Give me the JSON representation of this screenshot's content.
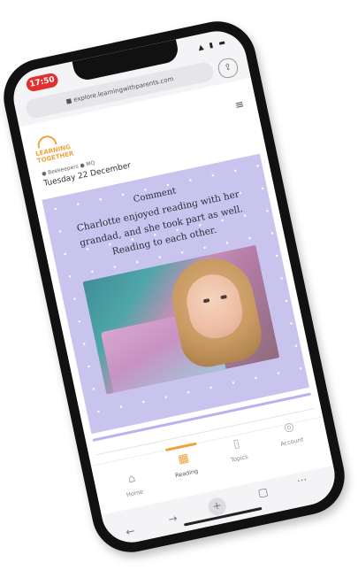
{
  "status_bar": {
    "time": "17:50",
    "icons": "▲ ▮ ▬"
  },
  "browser": {
    "url": "■ explore.learningwithparents.com",
    "share_icon": "share-icon"
  },
  "site": {
    "logo_text": "LEARNING\nTOGETHER",
    "menu_icon": "≡",
    "meta": "● Beekeepers ● MQ",
    "date": "Tuesday 22 December"
  },
  "comment": {
    "title": "Comment",
    "text": "Charlotte enjoyed reading with her grandad, and she took part as well. Reading to each other."
  },
  "tabs": [
    {
      "label": "Home",
      "icon": "⌂"
    },
    {
      "label": "Reading",
      "icon": "▦"
    },
    {
      "label": "Topics",
      "icon": "▯"
    },
    {
      "label": "Account",
      "icon": "◎"
    }
  ],
  "nav": {
    "back": "←",
    "forward": "→",
    "plus": "+",
    "tabs": "▢",
    "more": "···"
  },
  "colors": {
    "accent": "#f0a23b",
    "card": "#c9c4ee",
    "time_pill": "#e2302f"
  }
}
